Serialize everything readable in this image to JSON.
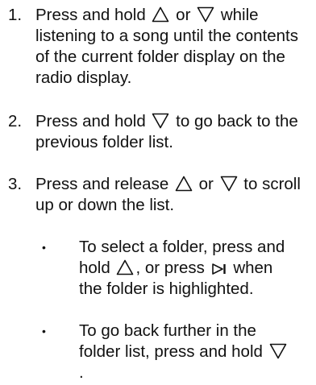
{
  "steps": [
    {
      "number": "1.",
      "parts": [
        "Press and hold",
        "or",
        "while listening to a song until the contents of the current folder display on the radio display."
      ],
      "icons": [
        "triangle-up",
        "triangle-down"
      ]
    },
    {
      "number": "2.",
      "parts": [
        "Press and hold",
        "to go back to the previous folder list."
      ],
      "icons": [
        "triangle-down"
      ]
    },
    {
      "number": "3.",
      "parts": [
        "Press and release",
        "or",
        "to scroll up or down the list."
      ],
      "icons": [
        "triangle-up",
        "triangle-down"
      ]
    }
  ],
  "bullets": [
    {
      "marker": "•",
      "parts": [
        "To select a folder, press and hold",
        ", or press",
        "when the folder is highlighted."
      ],
      "icons": [
        "triangle-up",
        "next-track"
      ]
    },
    {
      "marker": "•",
      "parts": [
        "To go back further in the folder list, press and hold",
        "."
      ],
      "icons": [
        "triangle-down"
      ]
    }
  ]
}
